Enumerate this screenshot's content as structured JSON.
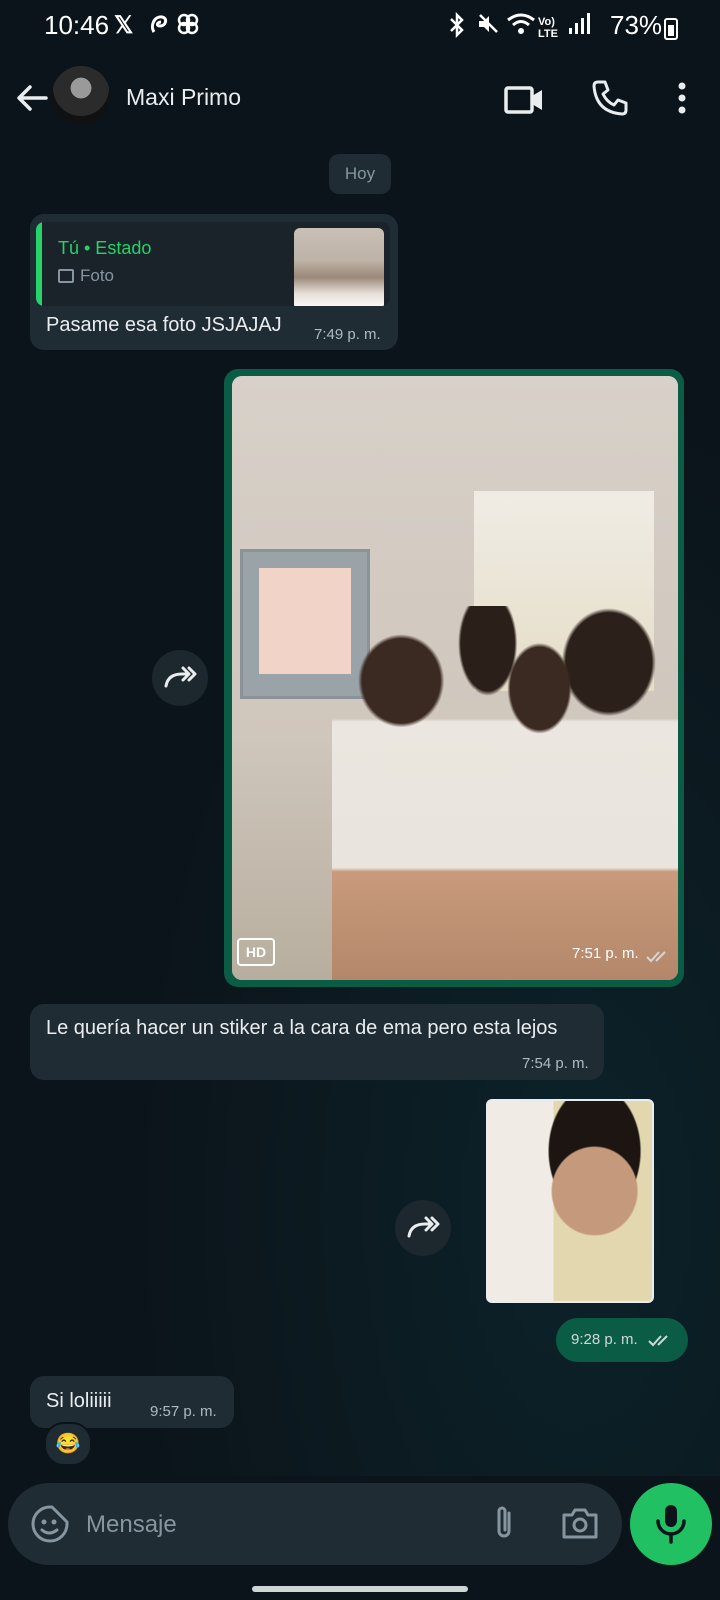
{
  "status_bar": {
    "time": "10:46",
    "battery": "73%",
    "icons": [
      "x-logo-icon",
      "threads-icon",
      "pinwheel-icon",
      "bluetooth-icon",
      "mute-icon",
      "wifi-icon",
      "volte-icon",
      "signal-icon",
      "battery-icon"
    ]
  },
  "header": {
    "contact_name": "Maxi Primo",
    "icons": [
      "back-arrow-icon",
      "video-call-icon",
      "phone-icon",
      "more-options-icon"
    ]
  },
  "chat": {
    "date_chip": "Hoy",
    "messages": [
      {
        "direction": "in",
        "quote_author": "Tú • Estado",
        "quote_type": "Foto",
        "text": "Pasame esa foto JSJAJAJ",
        "time": "7:49 p. m."
      },
      {
        "direction": "out",
        "kind": "photo",
        "badge": "HD",
        "time": "7:51 p. m."
      },
      {
        "direction": "in",
        "text": "Le quería hacer un stiker a la cara de ema pero esta lejos",
        "time": "7:54 p. m."
      },
      {
        "direction": "out",
        "kind": "sticker",
        "time": "9:28 p. m."
      },
      {
        "direction": "in",
        "text": "Si loliiiii",
        "time": "9:57 p. m.",
        "reaction": "😂"
      }
    ]
  },
  "composer": {
    "placeholder": "Mensaje",
    "icons": [
      "sticker-icon",
      "paperclip-icon",
      "camera-icon",
      "microphone-icon"
    ]
  },
  "colors": {
    "background": "#0b141a",
    "incoming_bubble": "#202c33",
    "outgoing_bubble": "#0b5c45",
    "accent_green": "#25d366",
    "mic_button": "#21c063",
    "read_check_gray": "#aebac1"
  }
}
